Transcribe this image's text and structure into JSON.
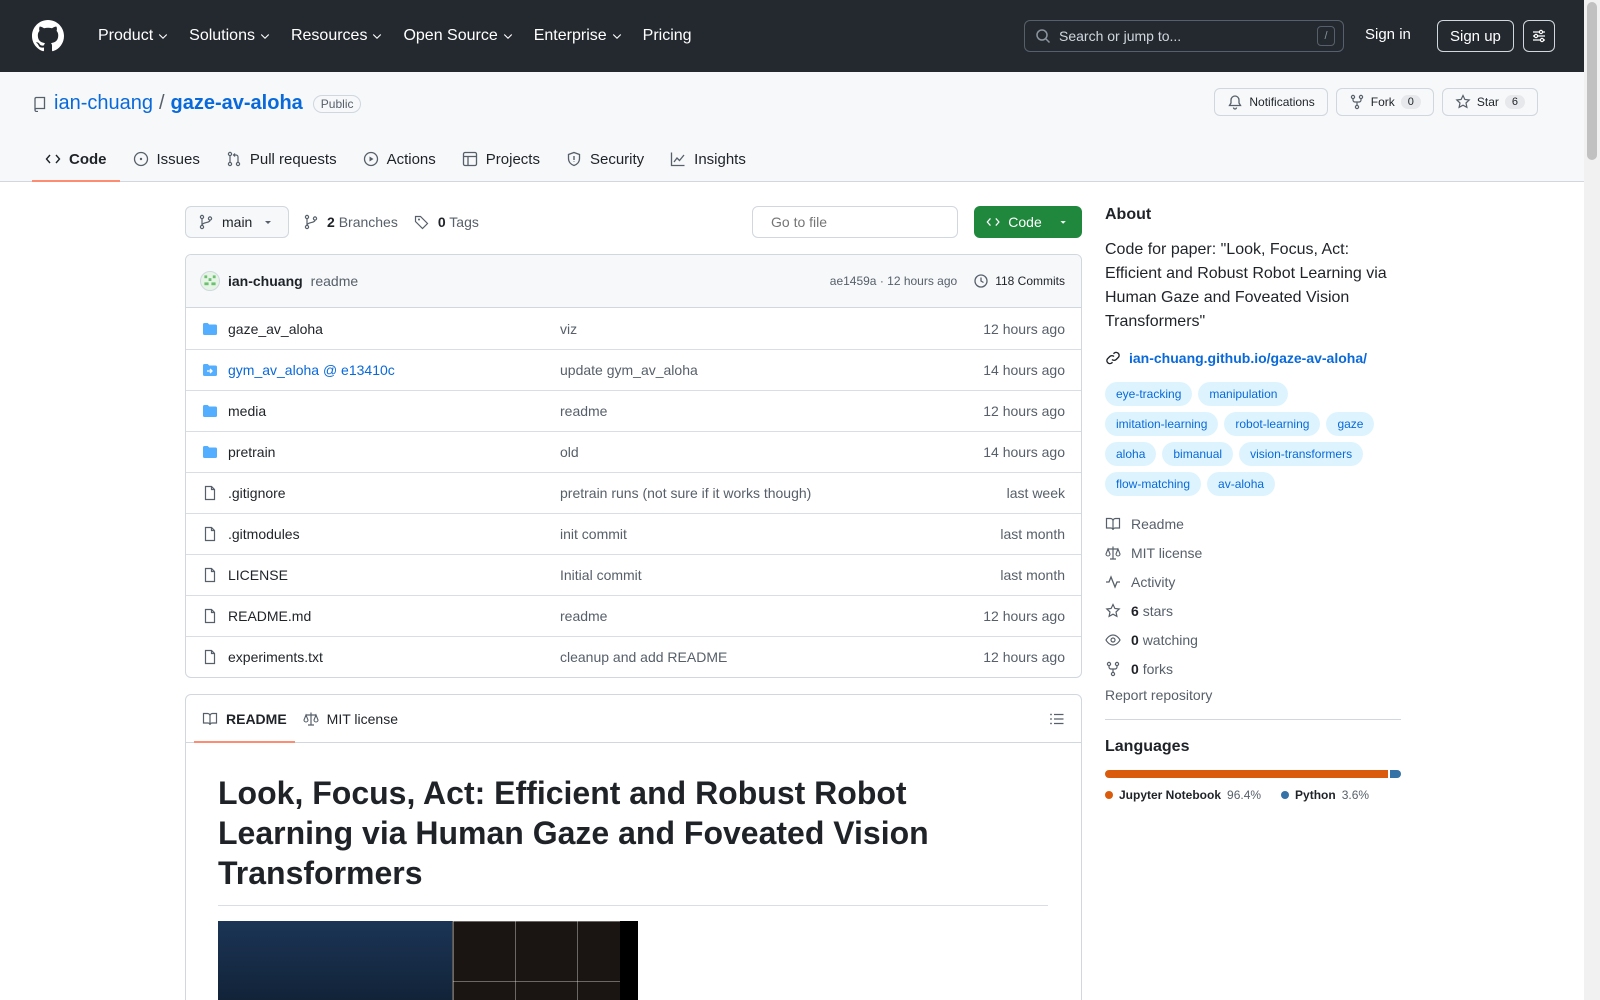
{
  "header": {
    "nav": [
      "Product",
      "Solutions",
      "Resources",
      "Open Source",
      "Enterprise",
      "Pricing"
    ],
    "search_placeholder": "Search or jump to...",
    "search_shortcut": "/",
    "sign_in": "Sign in",
    "sign_up": "Sign up"
  },
  "repo": {
    "owner": "ian-chuang",
    "separator": "/",
    "name": "gaze-av-aloha",
    "visibility": "Public",
    "notifications_label": "Notifications",
    "fork_label": "Fork",
    "fork_count": "0",
    "star_label": "Star",
    "star_count": "6"
  },
  "tabs": [
    "Code",
    "Issues",
    "Pull requests",
    "Actions",
    "Projects",
    "Security",
    "Insights"
  ],
  "toolbar": {
    "branch": "main",
    "branches_count": "2",
    "branches_label": "Branches",
    "tags_count": "0",
    "tags_label": "Tags",
    "goto_placeholder": "Go to file",
    "code_button": "Code"
  },
  "latest_commit": {
    "author": "ian-chuang",
    "message": "readme",
    "hash_time": "ae1459a · 12 hours ago",
    "commits": "118 Commits"
  },
  "files": [
    {
      "name": "gaze_av_aloha",
      "type": "folder",
      "message": "viz",
      "date": "12 hours ago"
    },
    {
      "name": "gym_av_aloha @ e13410c",
      "type": "submodule",
      "message": "update gym_av_aloha",
      "date": "14 hours ago"
    },
    {
      "name": "media",
      "type": "folder",
      "message": "readme",
      "date": "12 hours ago"
    },
    {
      "name": "pretrain",
      "type": "folder",
      "message": "old",
      "date": "14 hours ago"
    },
    {
      "name": ".gitignore",
      "type": "file",
      "message": "pretrain runs (not sure if it works though)",
      "date": "last week"
    },
    {
      "name": ".gitmodules",
      "type": "file",
      "message": "init commit",
      "date": "last month"
    },
    {
      "name": "LICENSE",
      "type": "file",
      "message": "Initial commit",
      "date": "last month"
    },
    {
      "name": "README.md",
      "type": "file",
      "message": "readme",
      "date": "12 hours ago"
    },
    {
      "name": "experiments.txt",
      "type": "file",
      "message": "cleanup and add README",
      "date": "12 hours ago"
    }
  ],
  "readme": {
    "tab_readme": "README",
    "tab_license": "MIT license",
    "title": "Look, Focus, Act: Efficient and Robust Robot Learning via Human Gaze and Foveated Vision Transformers"
  },
  "about": {
    "heading": "About",
    "description": "Code for paper: \"Look, Focus, Act: Efficient and Robust Robot Learning via Human Gaze and Foveated Vision Transformers\"",
    "homepage": "ian-chuang.github.io/gaze-av-aloha/",
    "topics": [
      "eye-tracking",
      "manipulation",
      "imitation-learning",
      "robot-learning",
      "gaze",
      "aloha",
      "bimanual",
      "vision-transformers",
      "flow-matching",
      "av-aloha"
    ],
    "readme_link": "Readme",
    "license_link": "MIT license",
    "activity_link": "Activity",
    "stars_count": "6",
    "stars_label": "stars",
    "watching_count": "0",
    "watching_label": "watching",
    "forks_count": "0",
    "forks_label": "forks",
    "report": "Report repository"
  },
  "languages": {
    "heading": "Languages",
    "items": [
      {
        "name": "Jupyter Notebook",
        "percent": "96.4%",
        "value": 96.4,
        "color": "#DA5B0B"
      },
      {
        "name": "Python",
        "percent": "3.6%",
        "value": 3.6,
        "color": "#3572A5"
      }
    ]
  }
}
